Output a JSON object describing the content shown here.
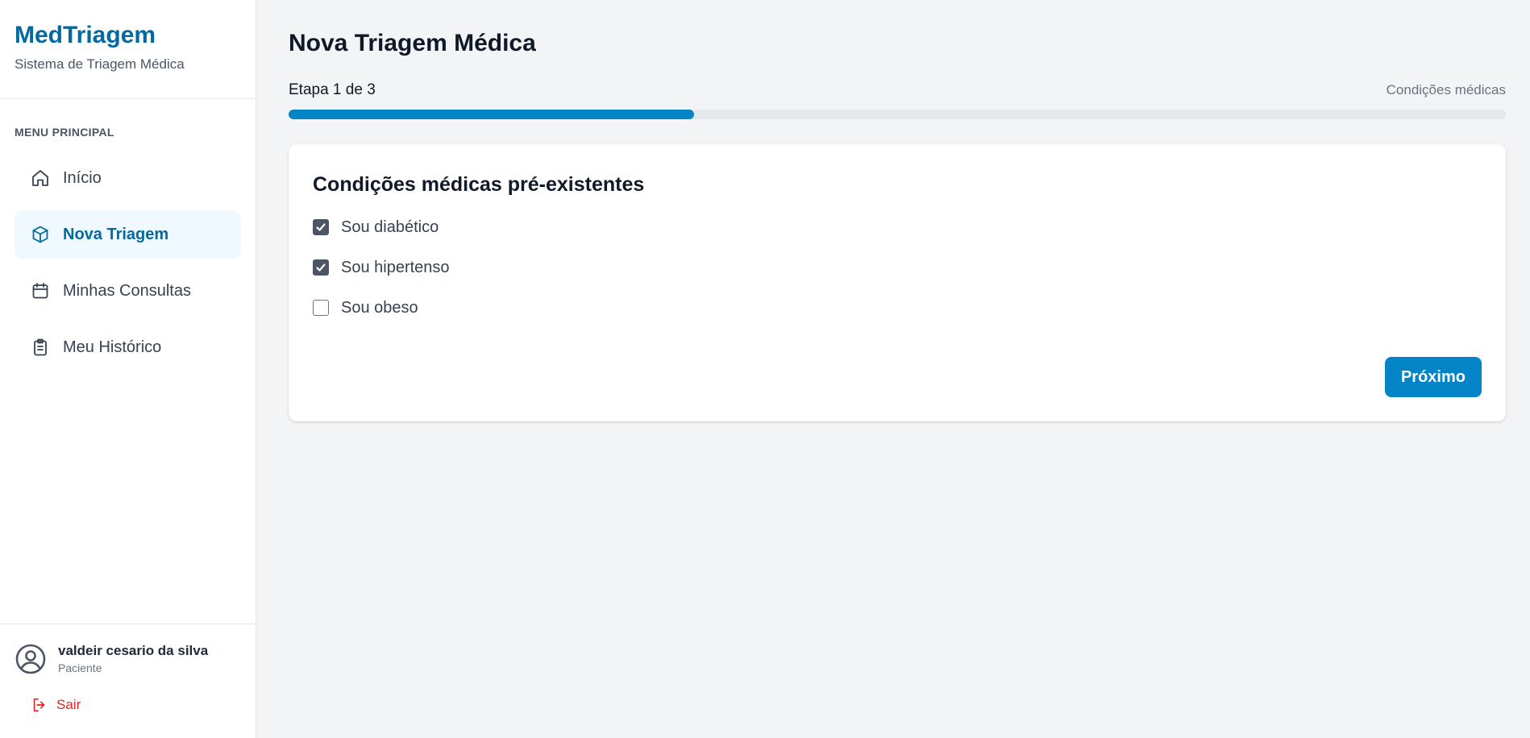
{
  "brand": {
    "title": "MedTriagem",
    "subtitle": "Sistema de Triagem Médica"
  },
  "sidebar": {
    "menu_heading": "MENU PRINCIPAL",
    "items": [
      {
        "label": "Início",
        "icon": "home-icon",
        "active": false
      },
      {
        "label": "Nova Triagem",
        "icon": "cube-icon",
        "active": true
      },
      {
        "label": "Minhas Consultas",
        "icon": "calendar-icon",
        "active": false
      },
      {
        "label": "Meu Histórico",
        "icon": "clipboard-icon",
        "active": false
      }
    ]
  },
  "user": {
    "name": "valdeir cesario da silva",
    "role": "Paciente",
    "avatar_icon": "user-circle-icon",
    "logout_label": "Sair",
    "logout_icon": "logout-icon"
  },
  "main": {
    "title": "Nova Triagem Médica",
    "step_label": "Etapa 1 de 3",
    "step_name": "Condições médicas",
    "progress_percent": 33.3
  },
  "form": {
    "title": "Condições médicas pré-existentes",
    "options": [
      {
        "label": "Sou diabético",
        "checked": true
      },
      {
        "label": "Sou hipertenso",
        "checked": true
      },
      {
        "label": "Sou obeso",
        "checked": false
      }
    ],
    "next_label": "Próximo"
  },
  "colors": {
    "brand": "#0369a1",
    "accent": "#0284c7",
    "active_bg": "#f0f9ff",
    "danger": "#dc2626",
    "page_bg": "#f3f4f6"
  }
}
